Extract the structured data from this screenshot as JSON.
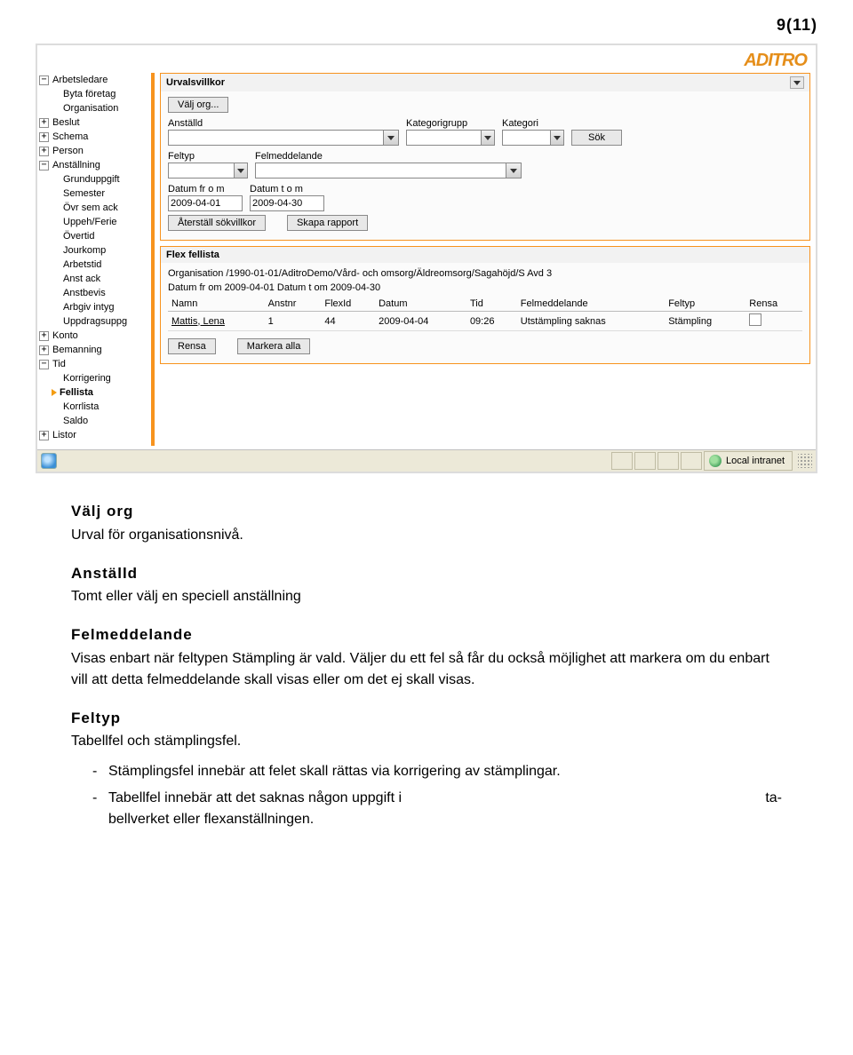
{
  "page_number": "9(11)",
  "brand": "ADITRO",
  "tree": [
    {
      "icon": "minus",
      "level": 0,
      "label": "Arbetsledare"
    },
    {
      "icon": "none",
      "level": 1,
      "label": "Byta företag"
    },
    {
      "icon": "none",
      "level": 1,
      "label": "Organisation"
    },
    {
      "icon": "plus",
      "level": 0,
      "label": "Beslut"
    },
    {
      "icon": "plus",
      "level": 0,
      "label": "Schema"
    },
    {
      "icon": "plus",
      "level": 0,
      "label": "Person"
    },
    {
      "icon": "minus",
      "level": 0,
      "label": "Anställning"
    },
    {
      "icon": "none",
      "level": 1,
      "label": "Grunduppgift"
    },
    {
      "icon": "none",
      "level": 1,
      "label": "Semester"
    },
    {
      "icon": "none",
      "level": 1,
      "label": "Övr sem ack"
    },
    {
      "icon": "none",
      "level": 1,
      "label": "Uppeh/Ferie"
    },
    {
      "icon": "none",
      "level": 1,
      "label": "Övertid"
    },
    {
      "icon": "none",
      "level": 1,
      "label": "Jourkomp"
    },
    {
      "icon": "none",
      "level": 1,
      "label": "Arbetstid"
    },
    {
      "icon": "none",
      "level": 1,
      "label": "Anst ack"
    },
    {
      "icon": "none",
      "level": 1,
      "label": "Anstbevis"
    },
    {
      "icon": "none",
      "level": 1,
      "label": "Arbgiv intyg"
    },
    {
      "icon": "none",
      "level": 1,
      "label": "Uppdragsuppg"
    },
    {
      "icon": "plus",
      "level": 0,
      "label": "Konto"
    },
    {
      "icon": "plus",
      "level": 0,
      "label": "Bemanning"
    },
    {
      "icon": "minus",
      "level": 0,
      "label": "Tid"
    },
    {
      "icon": "none",
      "level": 1,
      "label": "Korrigering"
    },
    {
      "icon": "marker",
      "level": 1,
      "label": "Fellista",
      "active": true
    },
    {
      "icon": "none",
      "level": 1,
      "label": "Korrlista"
    },
    {
      "icon": "none",
      "level": 1,
      "label": "Saldo"
    },
    {
      "icon": "plus",
      "level": 0,
      "label": "Listor"
    }
  ],
  "urval": {
    "title": "Urvalsvillkor",
    "valj_org": "Välj org...",
    "anstalld_label": "Anställd",
    "kategorigrupp_label": "Kategorigrupp",
    "kategori_label": "Kategori",
    "sok_label": "Sök",
    "feltyp_label": "Feltyp",
    "felmeddelande_label": "Felmeddelande",
    "datum_from_label": "Datum fr o m",
    "datum_tom_label": "Datum t o m",
    "datum_from": "2009-04-01",
    "datum_tom": "2009-04-30",
    "aterstall": "Återställ sökvillkor",
    "skapa": "Skapa rapport"
  },
  "fellista": {
    "title": "Flex fellista",
    "org_line": "Organisation /1990-01-01/AditroDemo/Vård- och omsorg/Äldreomsorg/Sagahöjd/S Avd 3",
    "date_line": "Datum fr om 2009-04-01 Datum t om 2009-04-30",
    "cols": [
      "Namn",
      "Anstnr",
      "FlexId",
      "Datum",
      "Tid",
      "Felmeddelande",
      "Feltyp",
      "Rensa"
    ],
    "row": {
      "namn": "Mattis, Lena",
      "anstnr": "1",
      "flexid": "44",
      "datum": "2009-04-04",
      "tid": "09:26",
      "felmed": "Utstämpling saknas",
      "feltyp": "Stämpling"
    },
    "rensa_btn": "Rensa",
    "markera_btn": "Markera alla"
  },
  "statusbar": {
    "zone": "Local intranet"
  },
  "doc": {
    "h1": "Välj org",
    "p1": "Urval för organisationsnivå.",
    "h2": "Anställd",
    "p2": "Tomt eller välj en speciell anställning",
    "h3": "Felmeddelande",
    "p3": "Visas enbart när feltypen Stämpling är vald. Väljer du ett fel så får du också möjlighet att markera om du enbart vill att detta felmeddelande skall visas eller om det ej skall visas.",
    "h4": "Feltyp",
    "p4": "Tabellfel och stämplingsfel.",
    "li1": "Stämplingsfel innebär att felet skall rättas via korrigering av stämplingar.",
    "li2a": "Tabellfel innebär att det saknas någon uppgift i",
    "li2b": "ta-",
    "li3": "bellverket eller flexanställningen."
  }
}
